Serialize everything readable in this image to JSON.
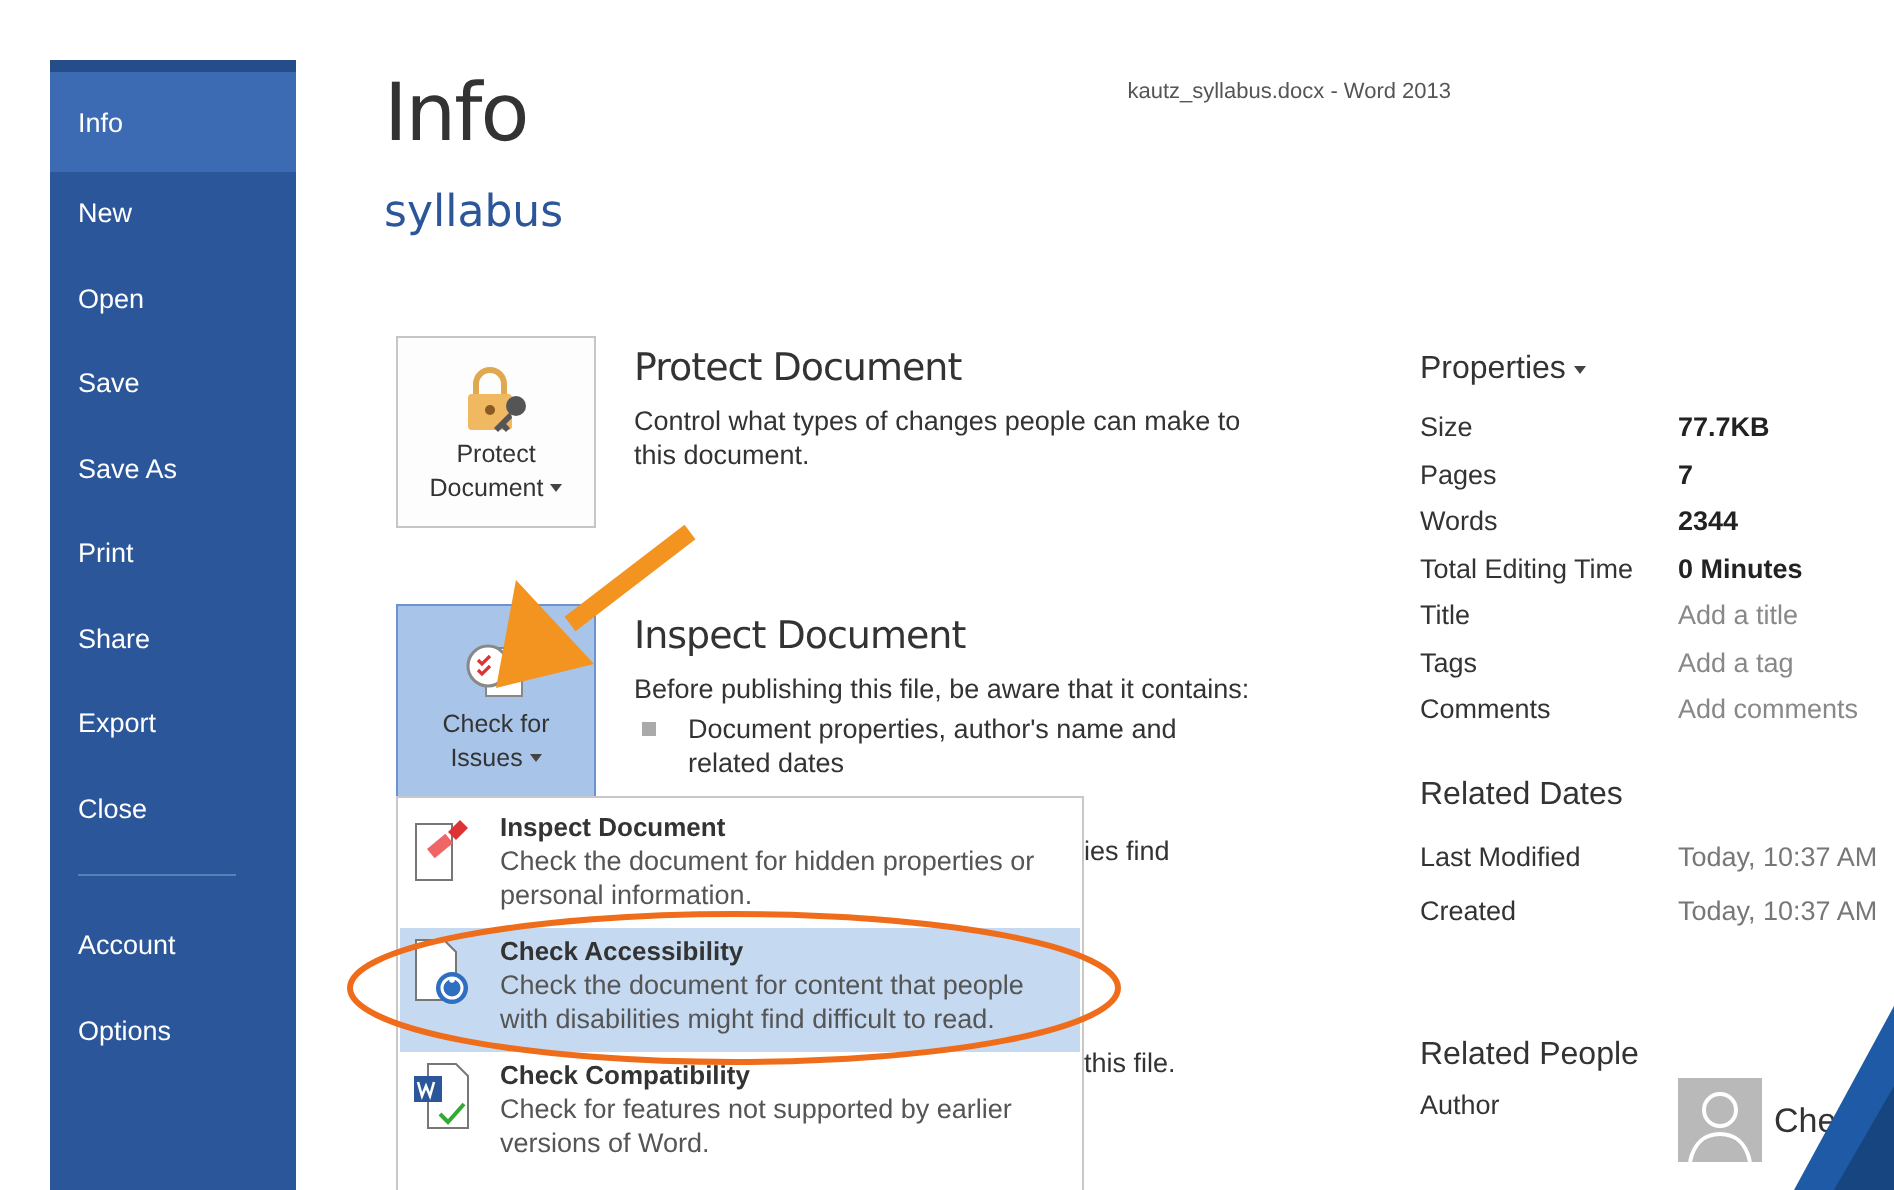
{
  "window": {
    "title": "kautz_syllabus.docx - Word 2013"
  },
  "sidebar": {
    "items": [
      {
        "label": "Info",
        "selected": true
      },
      {
        "label": "New",
        "selected": false
      },
      {
        "label": "Open",
        "selected": false
      },
      {
        "label": "Save",
        "selected": false
      },
      {
        "label": "Save As",
        "selected": false
      },
      {
        "label": "Print",
        "selected": false
      },
      {
        "label": "Share",
        "selected": false
      },
      {
        "label": "Export",
        "selected": false
      },
      {
        "label": "Close",
        "selected": false
      }
    ],
    "bottom_items": [
      {
        "label": "Account",
        "selected": false
      },
      {
        "label": "Options",
        "selected": false
      }
    ]
  },
  "page": {
    "title": "Info",
    "document_name": "syllabus"
  },
  "protect": {
    "button": [
      "Protect",
      "Document"
    ],
    "heading": "Protect Document",
    "description": "Control what types of changes people can make to this document."
  },
  "inspect": {
    "button": [
      "Check for",
      "Issues"
    ],
    "heading": "Inspect Document",
    "description": "Before publishing this file, be aware that it contains:",
    "bullets": [
      "Document properties, author's name and related dates"
    ],
    "hidden_fragments": [
      "ies find",
      "this file."
    ]
  },
  "issues_menu": [
    {
      "kind": "inspect",
      "title": "Inspect Document",
      "description": "Check the document for hidden properties or personal information.",
      "selected": false
    },
    {
      "kind": "accessibility",
      "title": "Check Accessibility",
      "description": "Check the document for content that people with disabilities might find difficult to read.",
      "selected": true
    },
    {
      "kind": "compatibility",
      "title": "Check Compatibility",
      "description": "Check for features not supported by earlier versions of Word.",
      "selected": false
    }
  ],
  "properties": {
    "heading": "Properties",
    "rows": [
      {
        "label": "Size",
        "value": "77.7KB"
      },
      {
        "label": "Pages",
        "value": "7"
      },
      {
        "label": "Words",
        "value": "2344"
      },
      {
        "label": "Total Editing Time",
        "value": "0 Minutes"
      },
      {
        "label": "Title",
        "placeholder": "Add a title"
      },
      {
        "label": "Tags",
        "placeholder": "Add a tag"
      },
      {
        "label": "Comments",
        "placeholder": "Add comments"
      }
    ]
  },
  "related_dates": {
    "heading": "Related Dates",
    "rows": [
      {
        "label": "Last Modified",
        "value": "Today, 10:37 AM"
      },
      {
        "label": "Created",
        "value": "Today, 10:37 AM"
      }
    ]
  },
  "related_people": {
    "heading": "Related People",
    "label": "Author",
    "name": "Che"
  }
}
